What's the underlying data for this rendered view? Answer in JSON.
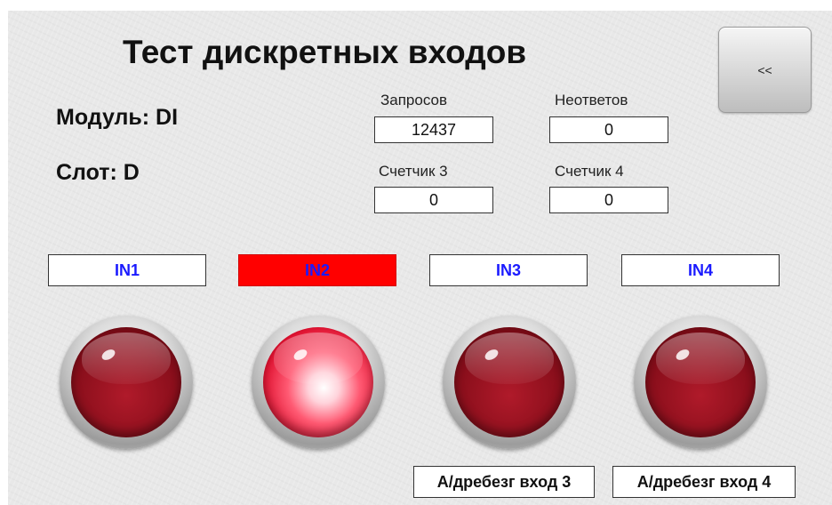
{
  "header": {
    "title": "Тест дискретных входов",
    "back_label": "<<"
  },
  "info": {
    "module": "Модуль: DI",
    "slot": "Слот: D"
  },
  "counters": [
    {
      "label": "Запросов",
      "value": "12437"
    },
    {
      "label": "Неответов",
      "value": "0"
    },
    {
      "label": "Счетчик 3",
      "value": "0"
    },
    {
      "label": "Счетчик 4",
      "value": "0"
    }
  ],
  "inputs": [
    {
      "label": "IN1",
      "state": "off"
    },
    {
      "label": "IN2",
      "state": "on"
    },
    {
      "label": "IN3",
      "state": "off"
    },
    {
      "label": "IN4",
      "state": "off"
    }
  ],
  "debounce": [
    {
      "label": "А/дребезг вход 3"
    },
    {
      "label": "А/дребезг вход 4"
    }
  ],
  "colors": {
    "input_label_text": "#1a1aff",
    "active_input_background": "#ff0000",
    "lamp_off": "#8c0f1c",
    "lamp_on": "#ff5a73"
  }
}
